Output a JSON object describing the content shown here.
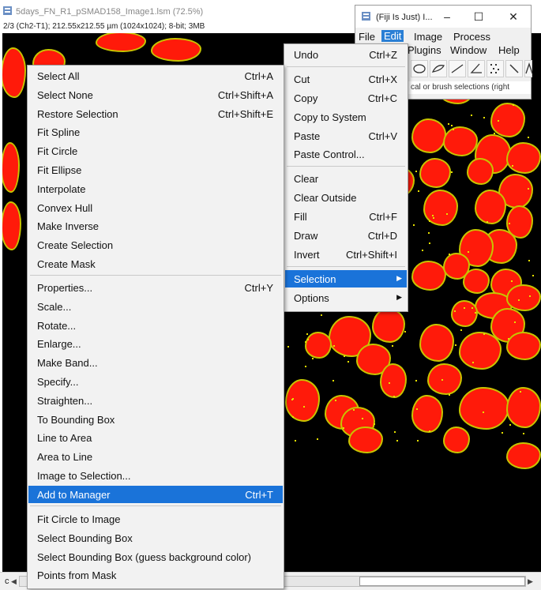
{
  "image_window": {
    "title": "5days_FN_R1_pSMAD158_Image1.lsm (72.5%)",
    "info": "2/3 (Ch2-T1); 212.55x212.55 µm (1024x1024); 8-bit; 3MB",
    "bottom_label": "c"
  },
  "fiji_window": {
    "title": "(Fiji Is Just) I...",
    "menus": [
      "File",
      "Edit",
      "Image",
      "Process",
      "Plugins",
      "Window",
      "Help"
    ],
    "status": "cal or brush selections (right"
  },
  "edit_menu": {
    "items": [
      {
        "label": "Undo",
        "shortcut": "Ctrl+Z"
      },
      {
        "label": "Cut",
        "shortcut": "Ctrl+X"
      },
      {
        "label": "Copy",
        "shortcut": "Ctrl+C"
      },
      {
        "label": "Copy to System",
        "shortcut": ""
      },
      {
        "label": "Paste",
        "shortcut": "Ctrl+V"
      },
      {
        "label": "Paste Control...",
        "shortcut": ""
      },
      {
        "label": "Clear",
        "shortcut": ""
      },
      {
        "label": "Clear Outside",
        "shortcut": ""
      },
      {
        "label": "Fill",
        "shortcut": "Ctrl+F"
      },
      {
        "label": "Draw",
        "shortcut": "Ctrl+D"
      },
      {
        "label": "Invert",
        "shortcut": "Ctrl+Shift+I"
      },
      {
        "label": "Selection",
        "shortcut": ""
      },
      {
        "label": "Options",
        "shortcut": ""
      }
    ]
  },
  "selection_menu": {
    "items": [
      {
        "label": "Select All",
        "shortcut": "Ctrl+A"
      },
      {
        "label": "Select None",
        "shortcut": "Ctrl+Shift+A"
      },
      {
        "label": "Restore Selection",
        "shortcut": "Ctrl+Shift+E"
      },
      {
        "label": "Fit Spline",
        "shortcut": ""
      },
      {
        "label": "Fit Circle",
        "shortcut": ""
      },
      {
        "label": "Fit Ellipse",
        "shortcut": ""
      },
      {
        "label": "Interpolate",
        "shortcut": ""
      },
      {
        "label": "Convex Hull",
        "shortcut": ""
      },
      {
        "label": "Make Inverse",
        "shortcut": ""
      },
      {
        "label": "Create Selection",
        "shortcut": ""
      },
      {
        "label": "Create Mask",
        "shortcut": ""
      },
      {
        "label": "Properties...",
        "shortcut": "Ctrl+Y"
      },
      {
        "label": "Scale...",
        "shortcut": ""
      },
      {
        "label": "Rotate...",
        "shortcut": ""
      },
      {
        "label": "Enlarge...",
        "shortcut": ""
      },
      {
        "label": "Make Band...",
        "shortcut": ""
      },
      {
        "label": "Specify...",
        "shortcut": ""
      },
      {
        "label": "Straighten...",
        "shortcut": ""
      },
      {
        "label": "To Bounding Box",
        "shortcut": ""
      },
      {
        "label": "Line to Area",
        "shortcut": ""
      },
      {
        "label": "Area to Line",
        "shortcut": ""
      },
      {
        "label": "Image to Selection...",
        "shortcut": ""
      },
      {
        "label": "Add to Manager",
        "shortcut": "Ctrl+T"
      },
      {
        "label": "Fit Circle to Image",
        "shortcut": ""
      },
      {
        "label": "Select Bounding Box",
        "shortcut": ""
      },
      {
        "label": "Select Bounding Box (guess background color)",
        "shortcut": ""
      },
      {
        "label": "Points from Mask",
        "shortcut": ""
      }
    ]
  },
  "colors": {
    "highlight": "#1a73d9",
    "cell_fill": "#ff1a0a",
    "cell_edge": "#c8c400"
  }
}
